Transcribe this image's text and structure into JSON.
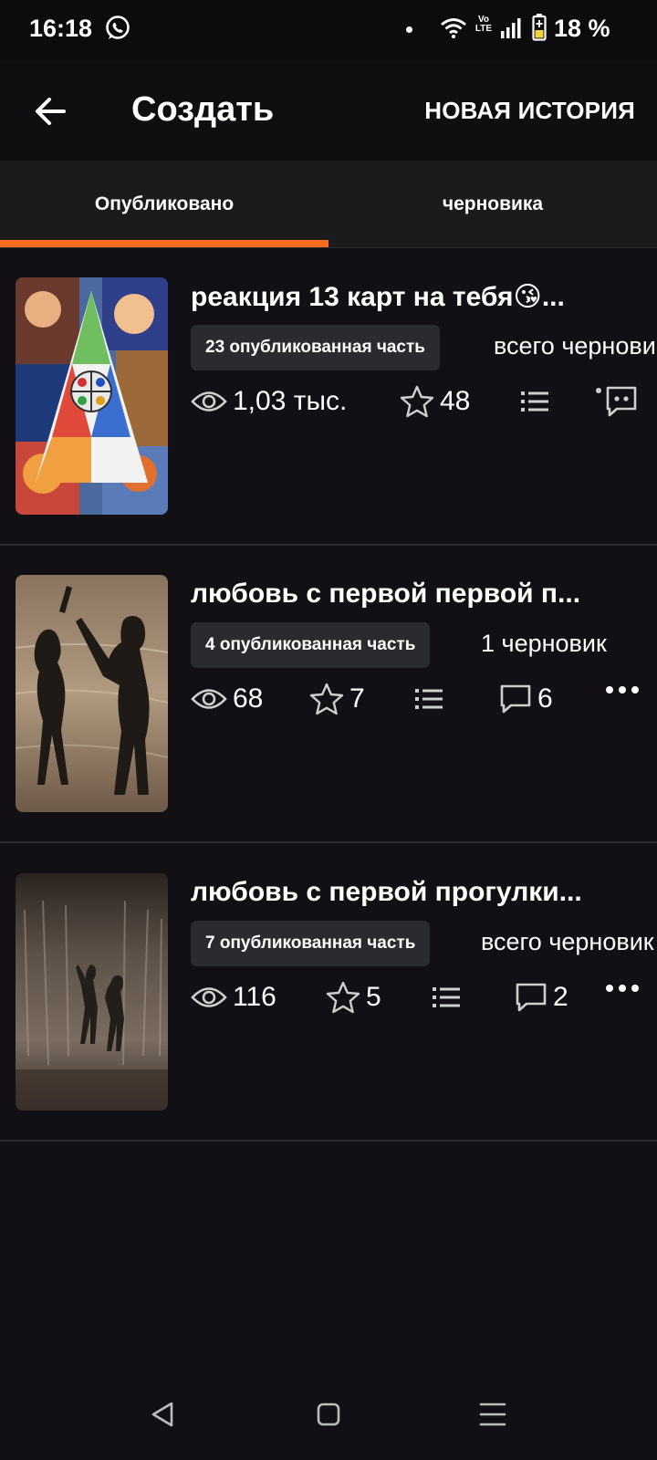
{
  "status_bar": {
    "time": "16:18",
    "volte_top": "Vo",
    "volte_bottom": "LTE",
    "battery": "18 %",
    "icons": [
      "whatsapp-icon",
      "wifi-icon",
      "signal-icon",
      "battery-icon"
    ]
  },
  "app_bar": {
    "back_icon": "arrow-left-icon",
    "title": "Создать",
    "action": "НОВАЯ ИСТОРИЯ"
  },
  "tabs": [
    {
      "label": "Опубликовано",
      "active": true
    },
    {
      "label": "черновика",
      "active": false
    }
  ],
  "accent_color": "#ff6d1f",
  "stories": [
    {
      "title": "реакция 13 карт на тебя😘...",
      "published_badge": "23 опубликованная часть",
      "drafts": "всего черновиков",
      "views": "1,03 тыс.",
      "votes": "48",
      "comments": ""
    },
    {
      "title": "любовь с первой первой п...",
      "published_badge": "4 опубликованная часть",
      "drafts": "1 черновик",
      "views": "68",
      "votes": "7",
      "comments": "6"
    },
    {
      "title": "любовь с первой прогулки...",
      "published_badge": "7 опубликованная часть",
      "drafts": "всего черновиков",
      "views": "116",
      "votes": "5",
      "comments": "2"
    }
  ],
  "nav_bar": {
    "buttons": [
      "back-nav-icon",
      "home-nav-icon",
      "recents-nav-icon"
    ]
  }
}
